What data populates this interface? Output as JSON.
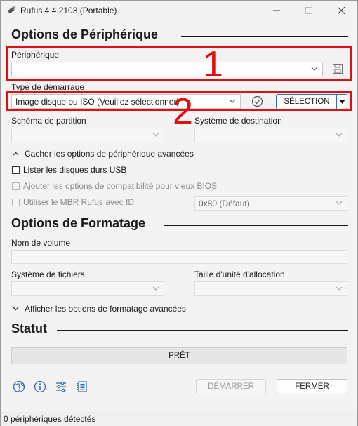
{
  "window": {
    "title": "Rufus 4.4.2103 (Portable)",
    "controls": [
      "minimize",
      "maximize",
      "close"
    ]
  },
  "device_options": {
    "heading": "Options de Périphérique",
    "device_label": "Périphérique",
    "device_value": "",
    "boot_type_label": "Type de démarrage",
    "boot_type_value": "Image disque ou ISO (Veuillez sélectionner)",
    "select_button": "SÉLECTION",
    "partition_scheme_label": "Schéma de partition",
    "target_system_label": "Système de destination",
    "advanced_toggle": "Cacher les options de périphérique avancées",
    "list_usb_label": "Lister les disques durs USB",
    "bios_compat_label": "Ajouter les options de compatibilité pour vieux BIOS",
    "rufus_mbr_label": "Utiliser le MBR Rufus avec ID",
    "mbr_id_value": "0x80 (Défaut)"
  },
  "format_options": {
    "heading": "Options de Formatage",
    "volume_label": "Nom de volume",
    "filesystem_label": "Système de fichiers",
    "cluster_size_label": "Taille d'unité d'allocation",
    "advanced_toggle": "Afficher les options de formatage avancées"
  },
  "status": {
    "heading": "Statut",
    "progress_text": "PRÊT"
  },
  "footer": {
    "start_button": "DÉMARRER",
    "close_button": "FERMER",
    "status_text": "0 périphériques détectés"
  },
  "annotations": {
    "box1_number": "1",
    "box2_number": "2",
    "color": "#e01010"
  }
}
